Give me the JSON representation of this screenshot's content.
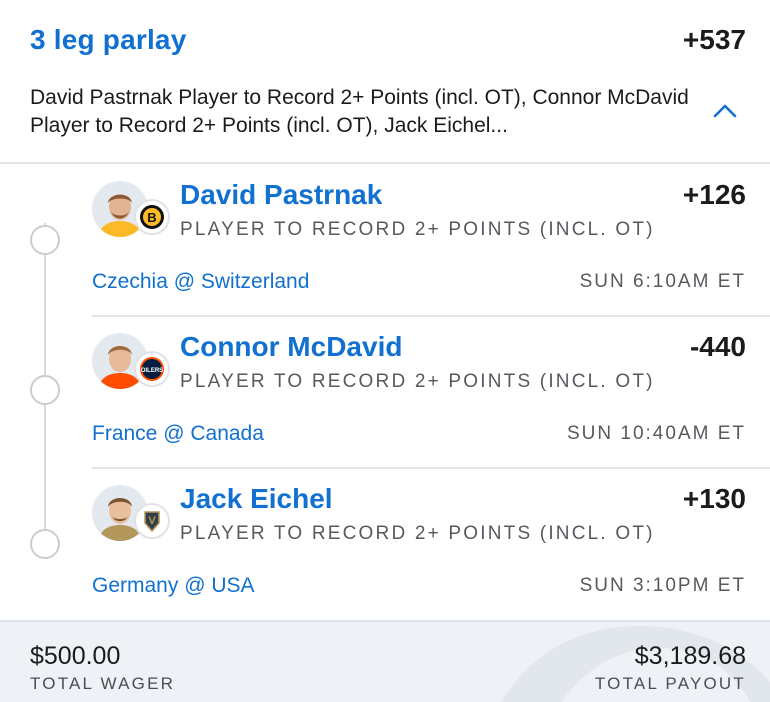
{
  "parlay": {
    "title": "3 leg parlay",
    "odds": "+537",
    "description": "David Pastrnak Player to Record 2+ Points (incl. OT), Connor McDavid Player to Record 2+ Points (incl. OT), Jack Eichel...",
    "collapse_icon": "chevron-up-icon"
  },
  "legs": [
    {
      "player": "David Pastrnak",
      "odds": "+126",
      "market": "PLAYER TO RECORD 2+ POINTS (INCL. OT)",
      "matchup": "Czechia @ Switzerland",
      "time": "SUN 6:10AM ET",
      "team_logo": "B",
      "team_logo_color": "#fdb927",
      "jersey_color": "#fdb927"
    },
    {
      "player": "Connor McDavid",
      "odds": "-440",
      "market": "PLAYER TO RECORD 2+ POINTS (INCL. OT)",
      "matchup": "France @ Canada",
      "time": "SUN 10:40AM ET",
      "team_logo": "OILERS",
      "team_logo_color": "#041e42",
      "jersey_color": "#ff4c00"
    },
    {
      "player": "Jack Eichel",
      "odds": "+130",
      "market": "PLAYER TO RECORD 2+ POINTS (INCL. OT)",
      "matchup": "Germany @ USA",
      "time": "SUN 3:10PM ET",
      "team_logo": "V",
      "team_logo_color": "#b4975a",
      "jersey_color": "#b4975a"
    }
  ],
  "totals": {
    "wager_value": "$500.00",
    "wager_label": "TOTAL WAGER",
    "payout_value": "$3,189.68",
    "payout_label": "TOTAL PAYOUT"
  },
  "colors": {
    "accent": "#1170d0",
    "text": "#1b1b1b",
    "muted": "#555a5f",
    "footer_bg": "#eef1f5"
  }
}
